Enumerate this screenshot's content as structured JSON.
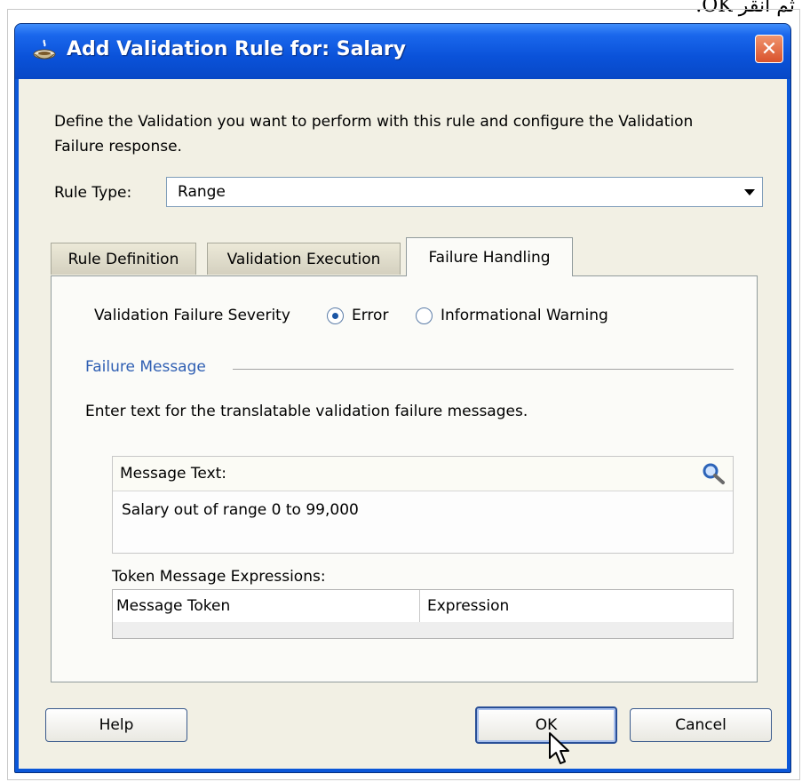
{
  "page": {
    "caption": "ثم انقر OK."
  },
  "dialog": {
    "title": "Add Validation Rule for: Salary",
    "close_label": "✕",
    "description": "Define the Validation you want to perform with this rule and configure the Validation Failure response.",
    "rule_type_label": "Rule Type:",
    "rule_type_value": "Range",
    "tabs": [
      {
        "label": "Rule Definition",
        "active": false
      },
      {
        "label": "Validation Execution",
        "active": false
      },
      {
        "label": "Failure Handling",
        "active": true
      }
    ],
    "severity_label": "Validation Failure Severity",
    "severity_options": [
      {
        "label": "Error",
        "selected": true
      },
      {
        "label": "Informational Warning",
        "selected": false
      }
    ],
    "failure_message_title": "Failure Message",
    "failure_message_instructions": "Enter text for the translatable validation failure messages.",
    "message_text_label": "Message Text:",
    "message_text_value": "Salary out of range 0 to 99,000",
    "token_expressions_label": "Token Message Expressions:",
    "token_columns": [
      "Message Token",
      "Expression"
    ],
    "buttons": {
      "help": "Help",
      "ok": "OK",
      "cancel": "Cancel"
    }
  },
  "icons": {
    "title": "jdeveloper-cup-icon",
    "search": "magnifier-icon",
    "cursor": "mouse-pointer-icon"
  },
  "colors": {
    "titlebar": "#0a52d9",
    "dialog_background": "#f2f0e4",
    "close_button": "#d9522c",
    "accent_text": "#2f5fb3"
  }
}
